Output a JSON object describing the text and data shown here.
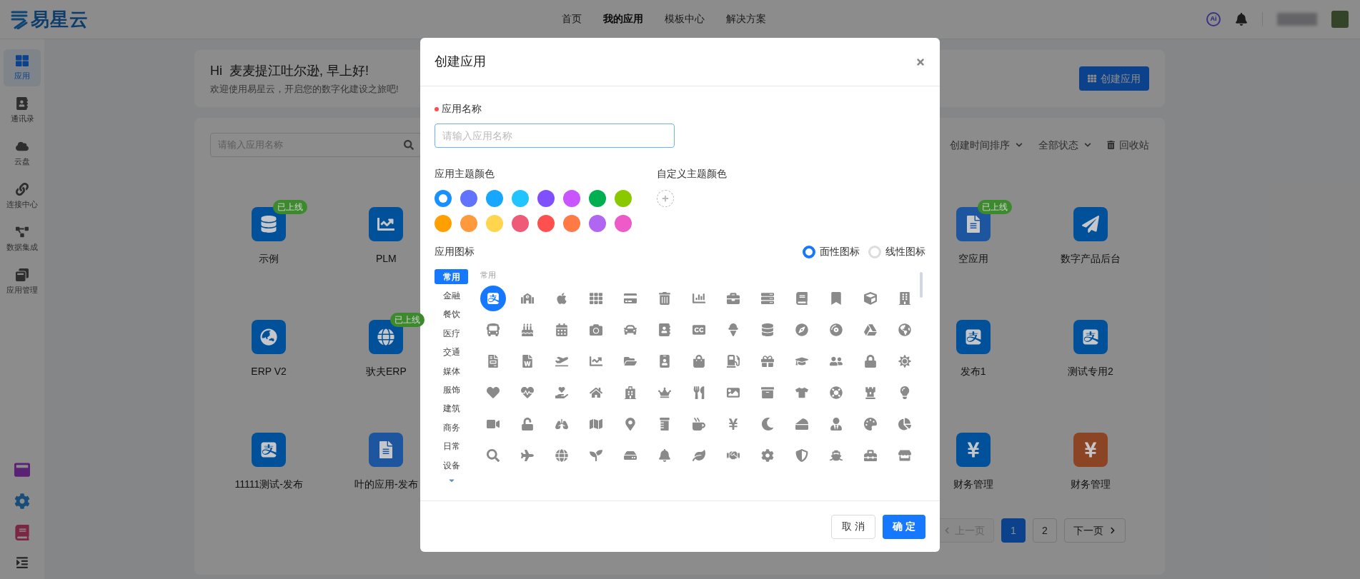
{
  "logo": {
    "text": "易星云"
  },
  "nav": [
    {
      "label": "首页",
      "selected": false
    },
    {
      "label": "我的应用",
      "selected": true
    },
    {
      "label": "模板中心",
      "selected": false
    },
    {
      "label": "解决方案",
      "selected": false
    }
  ],
  "top_right": {
    "ai_badge": "Ai"
  },
  "sidebar": {
    "items": [
      {
        "label": "应用",
        "selected": true
      },
      {
        "label": "通讯录",
        "selected": false
      },
      {
        "label": "云盘",
        "selected": false
      },
      {
        "label": "连接中心",
        "selected": false
      },
      {
        "label": "数据集成",
        "selected": false
      },
      {
        "label": "应用管理",
        "selected": false
      }
    ]
  },
  "welcome": {
    "greeting": "Hi  麦麦提江吐尔逊, 早上好!",
    "subtitle": "欢迎使用易星云，开启您的数字化建设之旅吧!",
    "create_button": "创建应用"
  },
  "toolbar": {
    "search": {
      "placeholder": "请输入应用名称"
    },
    "sort": "创建时间排序",
    "status": "全部状态",
    "recycle": "回收站"
  },
  "app_rows": [
    {
      "left": [
        {
          "name": "示例",
          "badge": "已上线",
          "color": "#00519a"
        },
        {
          "name": "PLM",
          "color": "#00519a"
        }
      ],
      "right": [
        {
          "name": "空应用",
          "badge": "已上线",
          "color": "#1d559e"
        },
        {
          "name": "数字产品后台",
          "color": "#00519a"
        }
      ]
    },
    {
      "left": [
        {
          "name": "ERP V2",
          "color": "#00519a"
        },
        {
          "name": "驮夫ERP",
          "badge": "已上线",
          "color": "#00519a"
        }
      ],
      "right": [
        {
          "name": "发布1",
          "color": "#00519a"
        },
        {
          "name": "测试专用2",
          "color": "#00519a"
        }
      ]
    },
    {
      "left": [
        {
          "name": "11111测试-发布",
          "color": "#00519a"
        },
        {
          "name": "叶的应用-发布",
          "color": "#1d559e"
        }
      ],
      "right": [
        {
          "name": "财务管理",
          "color": "#00519a"
        },
        {
          "name": "财务管理",
          "color": "#8c4524"
        }
      ]
    }
  ],
  "pagination": {
    "prev": {
      "label": "上一页",
      "disabled": true
    },
    "pages": [
      {
        "label": "1",
        "selected": true
      },
      {
        "label": "2",
        "selected": false
      }
    ],
    "next": {
      "label": "下一页",
      "disabled": false
    }
  },
  "dialog": {
    "title": "创建应用",
    "name_field": {
      "label": "应用名称",
      "required": true,
      "placeholder": "请输入应用名称"
    },
    "theme_colors": {
      "label": "应用主题颜色",
      "swatches": [
        {
          "color": "#1890ff",
          "selected": true
        },
        {
          "color": "#6173ff",
          "selected": false
        },
        {
          "color": "#17a7ff",
          "selected": false
        },
        {
          "color": "#22c4ff",
          "selected": false
        },
        {
          "color": "#8050ff",
          "selected": false
        },
        {
          "color": "#c855ff",
          "selected": false
        },
        {
          "color": "#00b050",
          "selected": false
        },
        {
          "color": "#8ac800",
          "selected": false
        },
        {
          "color": "#ffa000",
          "selected": false
        },
        {
          "color": "#ff9a3c",
          "selected": false
        },
        {
          "color": "#ffd54d",
          "selected": false
        },
        {
          "color": "#ee5a78",
          "selected": false
        },
        {
          "color": "#ff5050",
          "selected": false
        },
        {
          "color": "#ff7a45",
          "selected": false
        },
        {
          "color": "#b066f0",
          "selected": false
        },
        {
          "color": "#ee5ac8",
          "selected": false
        }
      ]
    },
    "custom_color": {
      "label": "自定义主题颜色"
    },
    "icon_picker": {
      "label": "应用图标",
      "styles": [
        {
          "label": "面性图标",
          "selected": true
        },
        {
          "label": "线性图标",
          "selected": false
        }
      ],
      "categories": [
        {
          "label": "常用",
          "selected": true
        },
        {
          "label": "金融",
          "selected": false
        },
        {
          "label": "餐饮",
          "selected": false
        },
        {
          "label": "医疗",
          "selected": false
        },
        {
          "label": "交通",
          "selected": false
        },
        {
          "label": "媒体",
          "selected": false
        },
        {
          "label": "服饰",
          "selected": false
        },
        {
          "label": "建筑",
          "selected": false
        },
        {
          "label": "商务",
          "selected": false
        },
        {
          "label": "日常",
          "selected": false
        },
        {
          "label": "设备",
          "selected": false
        }
      ],
      "section_title": "常用",
      "icons": [
        {
          "selected": true
        },
        {
          "selected": false
        },
        {
          "selected": false
        },
        {
          "selected": false
        },
        {
          "selected": false
        },
        {
          "selected": false
        },
        {
          "selected": false
        },
        {
          "selected": false
        },
        {
          "selected": false
        },
        {
          "selected": false
        },
        {
          "selected": false
        },
        {
          "selected": false
        },
        {
          "selected": false
        },
        {
          "selected": false
        },
        {
          "selected": false
        },
        {
          "selected": false
        },
        {
          "selected": false
        },
        {
          "selected": false
        },
        {
          "selected": false
        },
        {
          "selected": false
        },
        {
          "selected": false
        },
        {
          "selected": false
        },
        {
          "selected": false
        },
        {
          "selected": false
        },
        {
          "selected": false
        },
        {
          "selected": false
        },
        {
          "selected": false
        },
        {
          "selected": false
        },
        {
          "selected": false
        },
        {
          "selected": false
        },
        {
          "selected": false
        },
        {
          "selected": false
        },
        {
          "selected": false
        },
        {
          "selected": false
        },
        {
          "selected": false
        },
        {
          "selected": false
        },
        {
          "selected": false
        },
        {
          "selected": false
        },
        {
          "selected": false
        },
        {
          "selected": false
        },
        {
          "selected": false
        },
        {
          "selected": false
        },
        {
          "selected": false
        },
        {
          "selected": false
        },
        {
          "selected": false
        },
        {
          "selected": false
        },
        {
          "selected": false
        },
        {
          "selected": false
        },
        {
          "selected": false
        },
        {
          "selected": false
        },
        {
          "selected": false
        },
        {
          "selected": false
        },
        {
          "selected": false
        },
        {
          "selected": false
        },
        {
          "selected": false
        },
        {
          "selected": false
        },
        {
          "selected": false
        },
        {
          "selected": false
        },
        {
          "selected": false
        },
        {
          "selected": false
        },
        {
          "selected": false
        },
        {
          "selected": false
        },
        {
          "selected": false
        },
        {
          "selected": false
        },
        {
          "selected": false
        },
        {
          "selected": false
        },
        {
          "selected": false
        },
        {
          "selected": false
        },
        {
          "selected": false
        },
        {
          "selected": false
        },
        {
          "selected": false
        },
        {
          "selected": false
        },
        {
          "selected": false
        },
        {
          "selected": false
        },
        {
          "selected": false
        },
        {
          "selected": false
        },
        {
          "selected": false
        },
        {
          "selected": false
        }
      ]
    },
    "buttons": {
      "cancel": "取 消",
      "confirm": "确 定"
    }
  }
}
